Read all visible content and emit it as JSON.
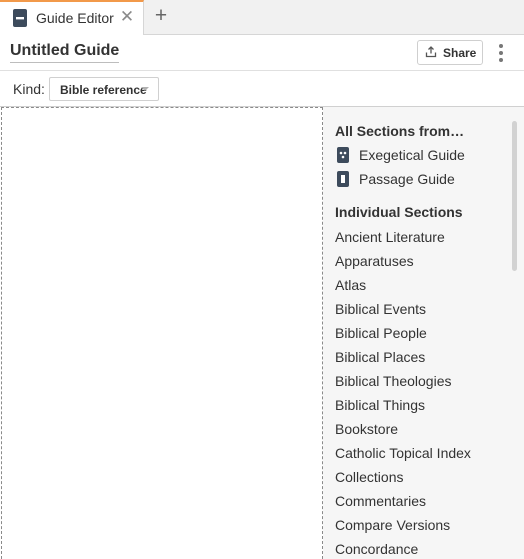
{
  "tab": {
    "title": "Guide Editor",
    "close_glyph": "✕",
    "new_tab_glyph": "+"
  },
  "header": {
    "guide_title": "Untitled Guide",
    "share_label": "Share"
  },
  "kind": {
    "label": "Kind:",
    "selected": "Bible reference"
  },
  "panel": {
    "all_sections_heading": "All Sections from…",
    "guides": [
      {
        "label": "Exegetical Guide",
        "icon": "exegetical-guide-icon"
      },
      {
        "label": "Passage Guide",
        "icon": "passage-guide-icon"
      }
    ],
    "individual_heading": "Individual Sections",
    "sections": [
      "Ancient Literature",
      "Apparatuses",
      "Atlas",
      "Biblical Events",
      "Biblical People",
      "Biblical Places",
      "Biblical Theologies",
      "Biblical Things",
      "Bookstore",
      "Catholic Topical Index",
      "Collections",
      "Commentaries",
      "Compare Versions",
      "Concordance"
    ]
  },
  "colors": {
    "accent_tab": "#f2994a",
    "icon_dark": "#3d4b5c"
  }
}
